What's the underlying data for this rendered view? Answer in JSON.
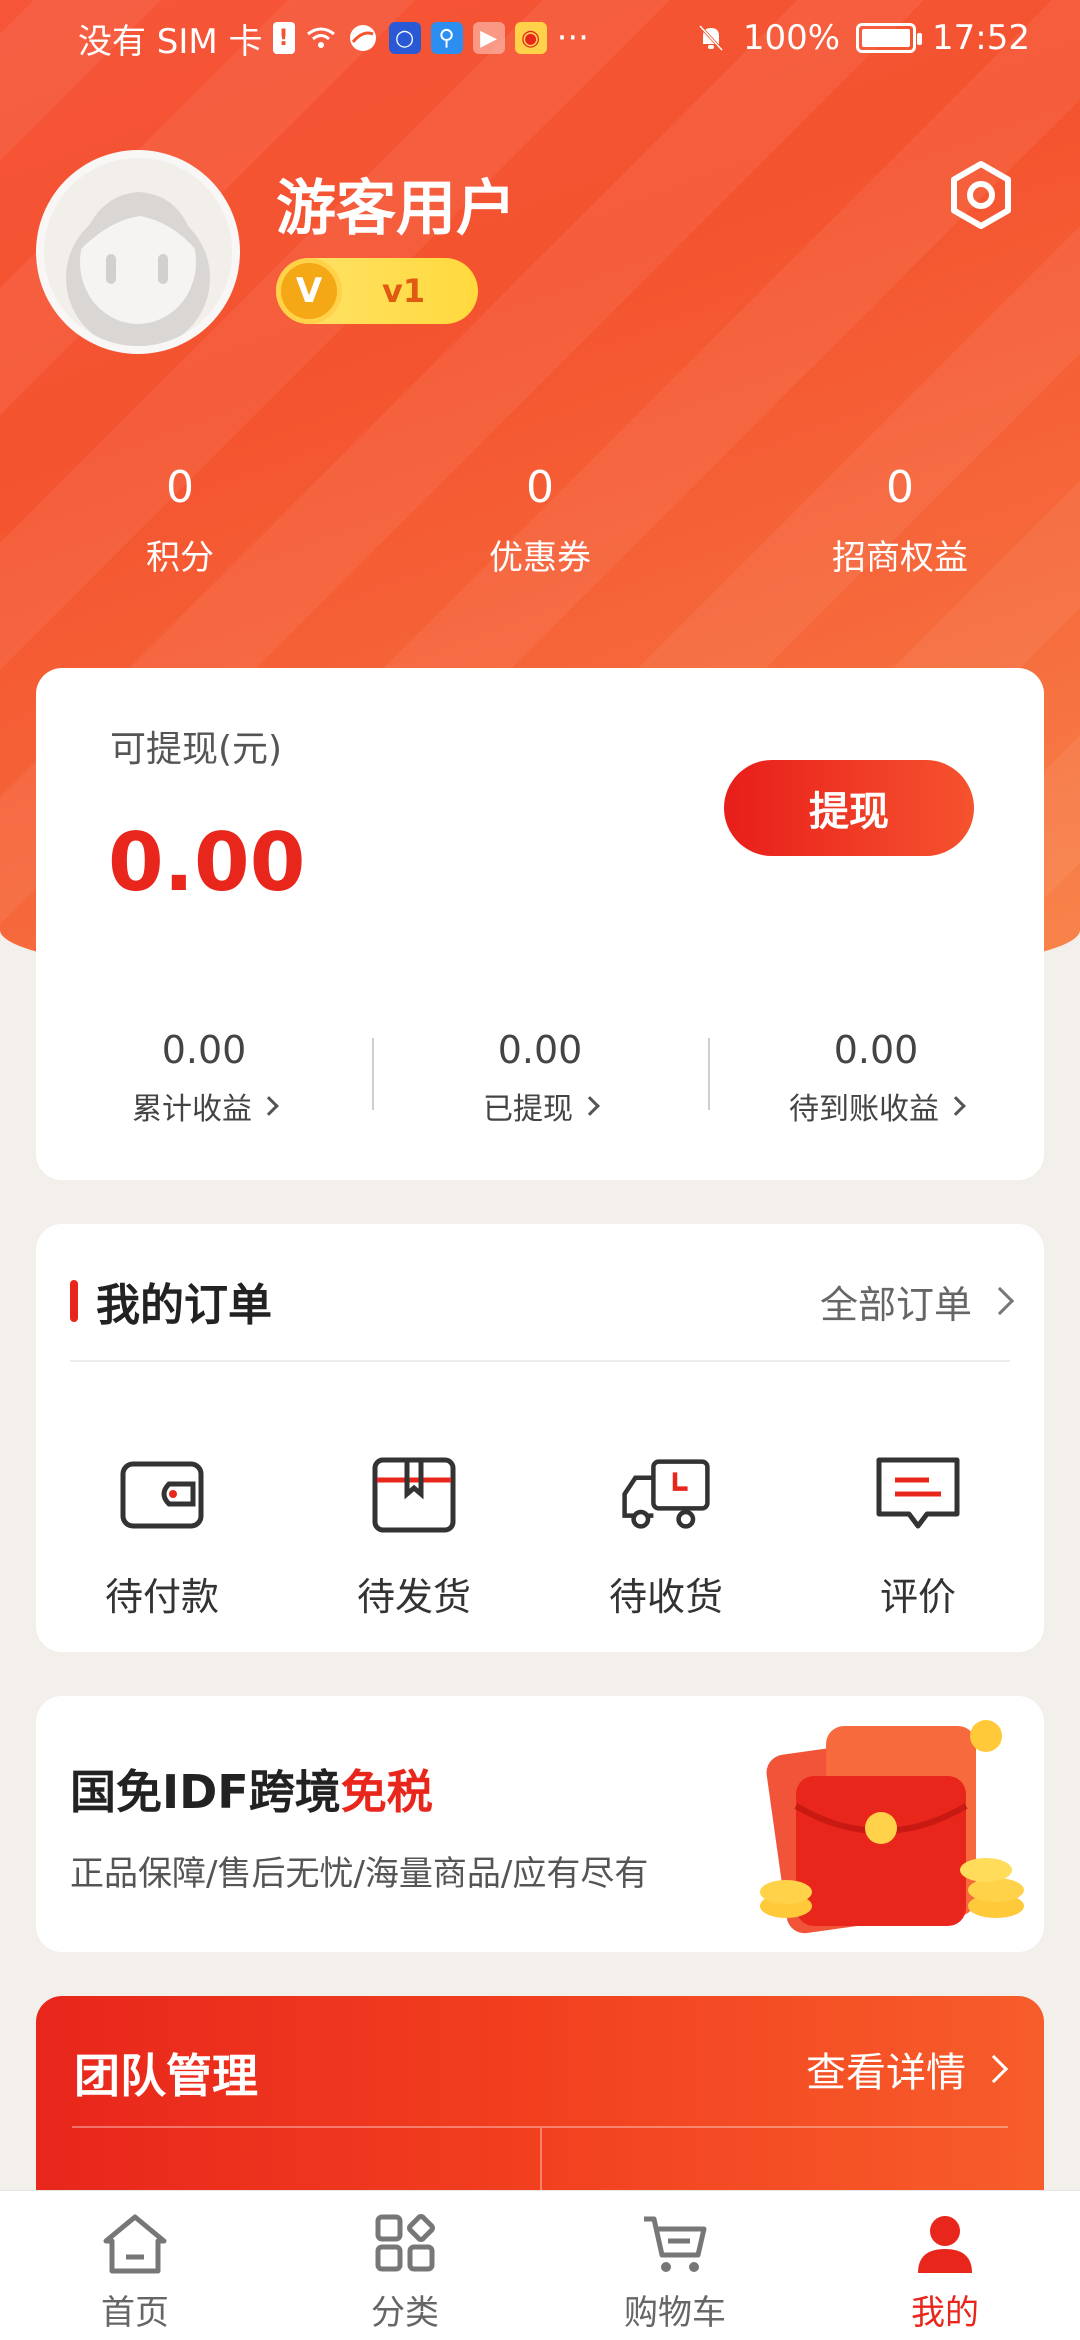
{
  "status_bar": {
    "carrier": "没有 SIM 卡",
    "more": "···",
    "battery": "100%",
    "time": "17:52"
  },
  "profile": {
    "name": "游客用户",
    "level": "v1",
    "level_coin": "V"
  },
  "stats": [
    {
      "value": "0",
      "label": "积分"
    },
    {
      "value": "0",
      "label": "优惠券"
    },
    {
      "value": "0",
      "label": "招商权益"
    }
  ],
  "withdraw": {
    "label": "可提现(元)",
    "amount": "0.00",
    "button": "提现",
    "items": [
      {
        "value": "0.00",
        "label": "累计收益"
      },
      {
        "value": "0.00",
        "label": "已提现"
      },
      {
        "value": "0.00",
        "label": "待到账收益"
      }
    ]
  },
  "orders": {
    "title": "我的订单",
    "all_link": "全部订单",
    "items": [
      {
        "label": "待付款",
        "icon": "wallet-icon"
      },
      {
        "label": "待发货",
        "icon": "box-icon"
      },
      {
        "label": "待收货",
        "icon": "truck-icon"
      },
      {
        "label": "评价",
        "icon": "comment-icon"
      }
    ]
  },
  "promo": {
    "title_prefix": "国免IDF跨境",
    "title_highlight": "免税",
    "subtitle": "正品保障/售后无忧/海量商品/应有尽有"
  },
  "team": {
    "title": "团队管理",
    "link": "查看详情"
  },
  "tabbar": [
    {
      "label": "首页",
      "icon": "home-icon",
      "active": false
    },
    {
      "label": "分类",
      "icon": "category-icon",
      "active": false
    },
    {
      "label": "购物车",
      "icon": "cart-icon",
      "active": false
    },
    {
      "label": "我的",
      "icon": "user-icon",
      "active": true
    }
  ],
  "colors": {
    "accent": "#e8261c",
    "hero": "#f4532f",
    "badge": "#ffd93d"
  }
}
